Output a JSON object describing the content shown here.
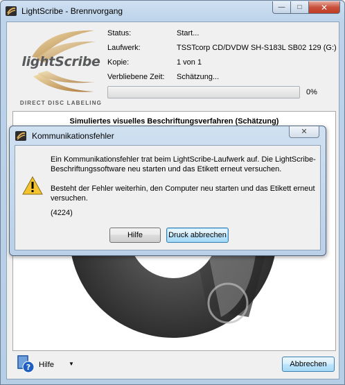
{
  "window": {
    "title": "LightScribe - Brennvorgang",
    "caption_buttons": {
      "minimize": "—",
      "maximize": "□",
      "close": "✕"
    }
  },
  "logo": {
    "word": "lightScribe",
    "tagline": "DIRECT DISC LABELING"
  },
  "status": {
    "rows": [
      {
        "label": "Status:",
        "value": "Start..."
      },
      {
        "label": "Laufwerk:",
        "value": "TSSTcorp CD/DVDW SH-S183L SB02 129 (G:)"
      },
      {
        "label": "Kopie:",
        "value": "1 von 1"
      },
      {
        "label": "Verbliebene Zeit:",
        "value": "Schätzung..."
      }
    ],
    "progress_fraction": 0,
    "percent_text": "0%"
  },
  "preview": {
    "title": "Simuliertes visuelles Beschriftungsverfahren (Schätzung)"
  },
  "footer": {
    "help_label": "Hilfe",
    "help_caret": "▼",
    "cancel_label": "Abbrechen"
  },
  "dialog": {
    "title": "Kommunikationsfehler",
    "close": "✕",
    "message1": "Ein Kommunikationsfehler trat beim LightScribe-Laufwerk auf.  Die LightScribe-Beschriftungssoftware neu starten und das Etikett erneut versuchen.",
    "message2": "Besteht der Fehler weiterhin, den Computer neu starten und das Etikett erneut versuchen.",
    "code": "(4224)",
    "help_button": "Hilfe",
    "abort_button": "Druck abbrechen"
  },
  "colors": {
    "accent": "#3c7fb1",
    "progress": "#37b44a",
    "logo_gold": "#c9a15a"
  },
  "icons": {
    "app": "lightscribe-icon",
    "warning": "warning-icon",
    "help": "help-book-icon"
  }
}
